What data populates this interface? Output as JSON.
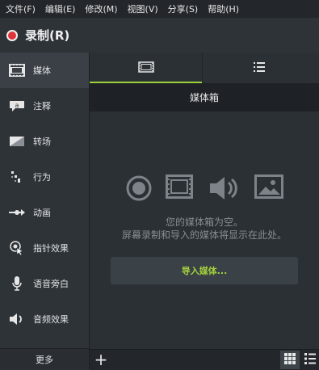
{
  "menubar": {
    "items": [
      {
        "label": "文件(F)"
      },
      {
        "label": "编辑(E)"
      },
      {
        "label": "修改(M)"
      },
      {
        "label": "视图(V)"
      },
      {
        "label": "分享(S)"
      },
      {
        "label": "帮助(H)"
      }
    ]
  },
  "record": {
    "label": "录制(R)",
    "color": "#e0343b"
  },
  "sidebar": {
    "items": [
      {
        "label": "媒体",
        "icon": "film-icon",
        "active": true
      },
      {
        "label": "注释",
        "icon": "callout-icon"
      },
      {
        "label": "转场",
        "icon": "transition-icon"
      },
      {
        "label": "行为",
        "icon": "behaviors-icon"
      },
      {
        "label": "动画",
        "icon": "animation-icon"
      },
      {
        "label": "指针效果",
        "icon": "cursor-effects-icon"
      },
      {
        "label": "语音旁白",
        "icon": "microphone-icon"
      },
      {
        "label": "音频效果",
        "icon": "speaker-icon"
      }
    ],
    "more_label": "更多"
  },
  "tabs": [
    {
      "icon": "film-icon",
      "active": true
    },
    {
      "icon": "list-icon",
      "active": false
    }
  ],
  "bin": {
    "title": "媒体箱",
    "type_icons": [
      "record-icon",
      "film-icon",
      "audio-icon",
      "image-icon"
    ],
    "empty_line1": "您的媒体箱为空。",
    "empty_line2": "屏幕录制和导入的媒体将显示在此处。",
    "import_label": "导入媒体..."
  },
  "bottombar": {
    "plus_label": "+",
    "view_modes": [
      "grid-view-icon",
      "list-view-icon"
    ]
  },
  "colors": {
    "accent": "#9bd13b",
    "import_text": "#a4d23c",
    "background": "#2b3035"
  }
}
